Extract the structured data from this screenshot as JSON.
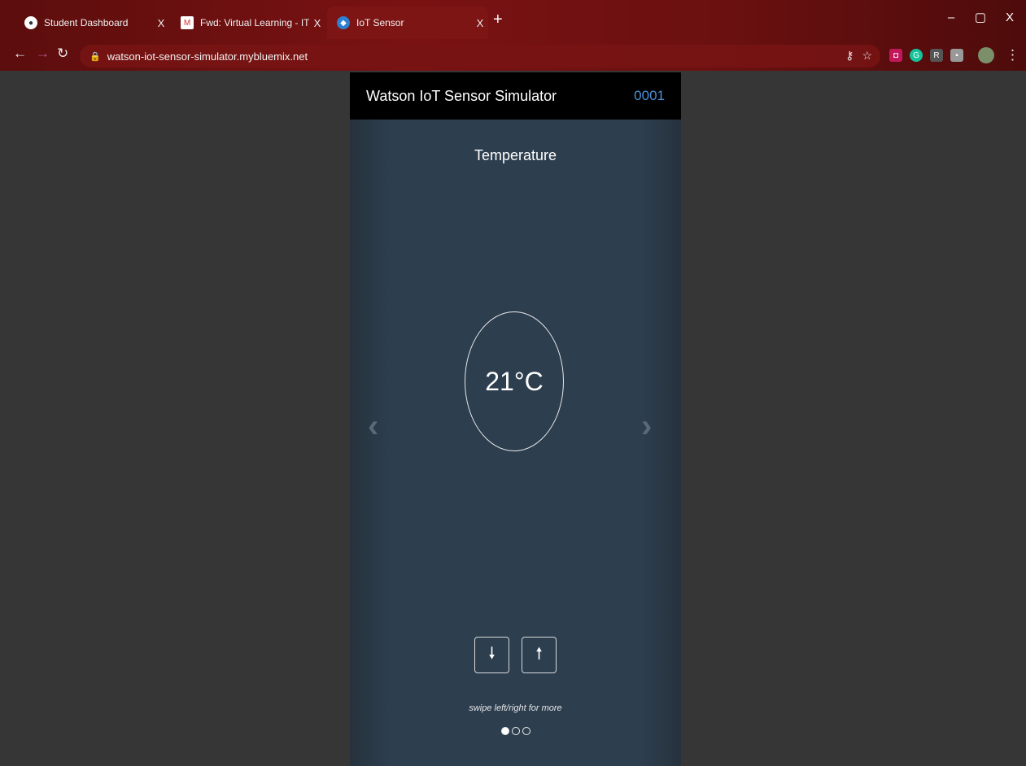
{
  "browser": {
    "tabs": [
      {
        "title": "Student Dashboard",
        "icon": "globe-icon",
        "active": false
      },
      {
        "title": "Fwd: Virtual Learning - IT Skill Ce",
        "icon": "gmail-icon",
        "active": false
      },
      {
        "title": "IoT Sensor",
        "icon": "ibm-cloud-icon",
        "active": true
      }
    ],
    "close_glyph": "X",
    "new_tab_glyph": "+",
    "url": "watson-iot-sensor-simulator.mybluemix.net",
    "window_controls": [
      "–",
      "▢",
      "X"
    ]
  },
  "app": {
    "title": "Watson IoT Sensor Simulator",
    "device_id": "0001",
    "sensor_name": "Temperature",
    "reading": "21°C",
    "prev_glyph": "‹",
    "next_glyph": "›",
    "decrease_glyph": "🠗",
    "increase_glyph": "🠕",
    "hint": "swipe left/right for more",
    "pager": {
      "count": 3,
      "current": 1
    },
    "accent_color": "#4a90d9"
  }
}
